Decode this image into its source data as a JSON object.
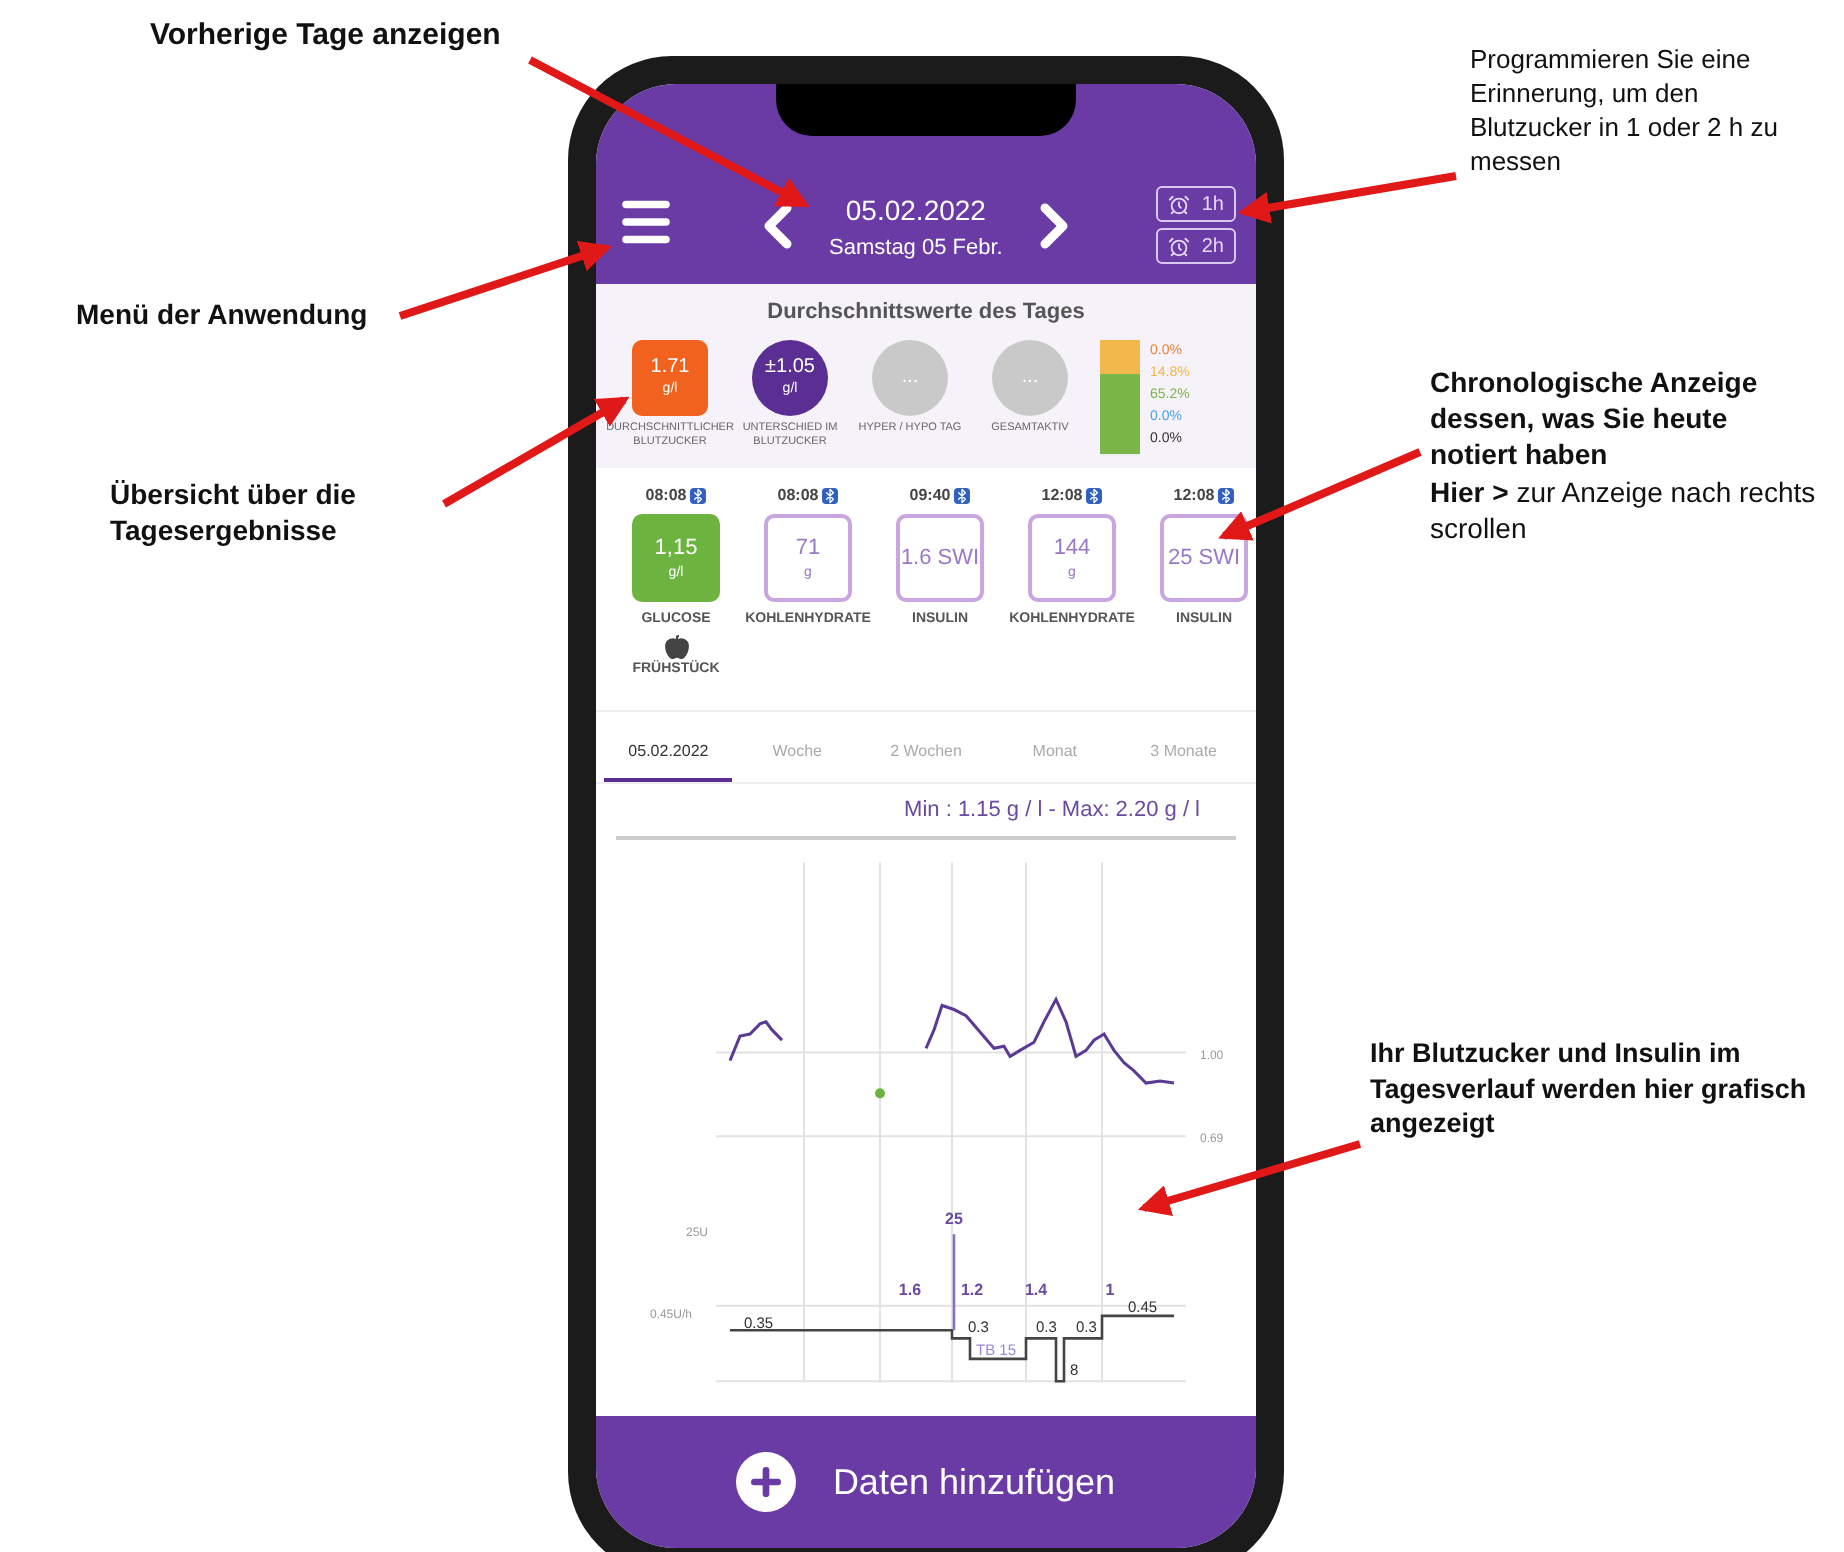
{
  "annotations": [
    {
      "text": "Vorherige Tage anzeigen",
      "bold": true
    },
    {
      "text": "Menü der Anwendung",
      "bold": true
    },
    {
      "text": "Übersicht über die Tagesergebnisse",
      "bold": true
    },
    {
      "text": "Programmieren Sie eine Erinnerung, um den Blutzucker in 1 oder 2 h zu messen",
      "bold": false
    },
    {
      "text": "Chronologische Anzeige dessen, was Sie heute notiert haben",
      "bold": true,
      "note": "**Hier >** zur Anzeige nach rechts scrollen"
    },
    {
      "text": "Ihr Blutzucker und Insulin im Tagesverlauf werden hier grafisch angezeigt",
      "bold": true
    }
  ],
  "header": {
    "date": "05.02.2022",
    "weekday": "Samstag 05 Febr.",
    "reminders": [
      "1h",
      "2h"
    ]
  },
  "summary": {
    "title": "Durchschnittswerte des Tages",
    "stats": [
      {
        "kind": "square",
        "color": "#f0621e",
        "value": "1.71",
        "unit": "g/l",
        "label": "DURCHSCHNITTLICHER BLUTZUCKER"
      },
      {
        "kind": "circle",
        "color": "#5b2e94",
        "value": "±1.05",
        "unit": "g/l",
        "label": "UNTERSCHIED IM BLUTZUCKER"
      },
      {
        "kind": "circle",
        "color": "#c9c9c9",
        "value": "...",
        "label": "HYPER / HYPO TAG"
      },
      {
        "kind": "circle",
        "color": "#c9c9c9",
        "value": "...",
        "label": "GESAMTAKTIV"
      }
    ],
    "ranges": [
      {
        "reading": "0.0%",
        "color": "#e8833a"
      },
      {
        "reading": "14.8%",
        "color": "#f2b84b",
        "level": 0.3
      },
      {
        "reading": "65.2%",
        "color": "#7ab648",
        "level": 0.7
      },
      {
        "reading": "0.0%",
        "color": "#4aa3df"
      },
      {
        "reading": "0.0%",
        "color": "#333333"
      }
    ]
  },
  "entries": [
    {
      "time": "08:08",
      "kind": "glucose",
      "value": "1,15",
      "unit": "g/l",
      "label": "GLUCOSE",
      "meal": "FRÜHSTÜCK"
    },
    {
      "time": "08:08",
      "kind": "outlined",
      "value": "71",
      "unit": "g",
      "label": "KOHLENHYDRATE"
    },
    {
      "time": "09:40",
      "kind": "outlined",
      "value": "1.6 SWI",
      "label": "INSULIN"
    },
    {
      "time": "12:08",
      "kind": "outlined",
      "value": "144",
      "unit": "g",
      "label": "KOHLENHYDRATE"
    },
    {
      "time": "12:08",
      "kind": "outlined",
      "value": "25 SWI",
      "label": "INSULIN"
    }
  ],
  "tabs": [
    {
      "label": "05.02.2022",
      "selected": true
    },
    {
      "label": "Woche",
      "selected": false
    },
    {
      "label": "2 Wochen",
      "selected": false
    },
    {
      "label": "Monat",
      "selected": false
    },
    {
      "label": "3 Monate",
      "selected": false
    }
  ],
  "range_text": "Min : 1.15 g / l - Max: 2.20 g / l",
  "chart": {
    "glucose_ticks": [
      "1.00",
      "0.69"
    ],
    "insulin_ticks": [
      "25U",
      "0.45U/h"
    ],
    "bolus_labels": [
      "25",
      "1.6",
      "1.2",
      "1.4",
      "1"
    ],
    "basal_labels": [
      "0.35",
      "0.3",
      "TB 15",
      "0.3",
      "0.3",
      "0.45",
      "8"
    ]
  },
  "add_button": "Daten hinzufügen"
}
